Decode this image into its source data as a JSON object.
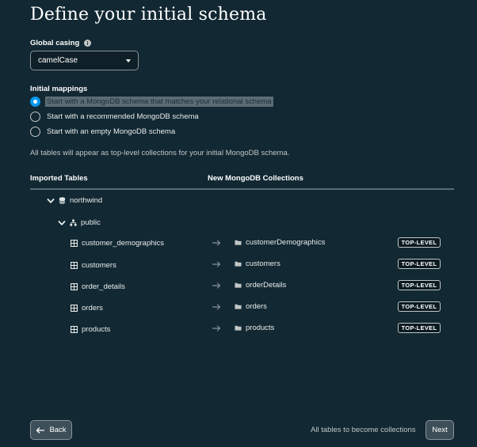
{
  "page": {
    "title": "Define your initial schema"
  },
  "global_casing": {
    "label": "Global casing",
    "info_icon": "info-icon",
    "selected": "camelCase"
  },
  "initial_mappings": {
    "label": "Initial mappings",
    "options": [
      {
        "label": "Start with a MongoDB schema that matches your relational schema",
        "checked": true
      },
      {
        "label": "Start with a recommended MongoDB schema",
        "checked": false
      },
      {
        "label": "Start with an empty MongoDB schema",
        "checked": false
      }
    ]
  },
  "note": "All tables will appear as top-level collections for your initial MongoDB schema.",
  "columns": {
    "imported": "Imported Tables",
    "collections": "New MongoDB Collections"
  },
  "tree": {
    "database": "northwind",
    "schema": "public",
    "rows": [
      {
        "table": "customer_demographics",
        "collection": "customerDemographics",
        "badge": "TOP-LEVEL"
      },
      {
        "table": "customers",
        "collection": "customers",
        "badge": "TOP-LEVEL"
      },
      {
        "table": "order_details",
        "collection": "orderDetails",
        "badge": "TOP-LEVEL"
      },
      {
        "table": "orders",
        "collection": "orders",
        "badge": "TOP-LEVEL"
      },
      {
        "table": "products",
        "collection": "products",
        "badge": "TOP-LEVEL"
      }
    ]
  },
  "footer": {
    "back_label": "Back",
    "status": "All tables to become collections",
    "next_label": "Next"
  },
  "colors": {
    "background": "#122833",
    "accent": "#0498ec",
    "button_bg": "#3d4f58"
  }
}
